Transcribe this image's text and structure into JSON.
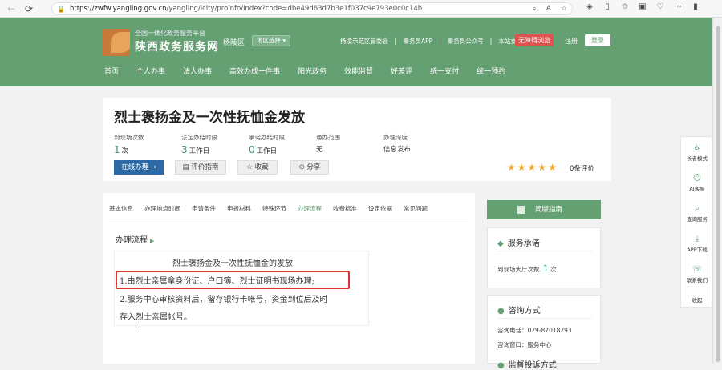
{
  "browser": {
    "back_icon": "←",
    "refresh_icon": "⟳",
    "lock_icon": "🔒",
    "url_host": "https://zwfw.yangling.gov.cn",
    "url_path": "/yangling/icity/proinfo/index?code=dbe49d63d7b3e1f037c9e793e0c0c14b"
  },
  "header": {
    "site_sub": "全国一体化政务服务平台",
    "site_name": "陕西政务服务网",
    "region": "杨陵区",
    "region_select": "地区选择",
    "top_links": [
      "杨凌示范区管委会",
      "秦务员APP",
      "秦务员公众号",
      "本站支持IPv6"
    ],
    "a11y_button": "无障碍浏览",
    "register": "注册",
    "login": "登录",
    "nav": [
      "首页",
      "个人办事",
      "法人办事",
      "高效办成一件事",
      "阳光政务",
      "效能监督",
      "好差评",
      "统一支付",
      "统一预约"
    ]
  },
  "service": {
    "title": "烈士褒扬金及一次性抚恤金发放",
    "stats": [
      {
        "label": "到现场次数",
        "num": "1",
        "unit": "次"
      },
      {
        "label": "法定办结时限",
        "num": "3",
        "unit": "工作日"
      },
      {
        "label": "承诺办结时限",
        "num": "0",
        "unit": "工作日"
      },
      {
        "label": "通办范围",
        "num": "",
        "unit": "无"
      },
      {
        "label": "办理深度",
        "num": "",
        "unit": "信息发布"
      }
    ],
    "online_button": "在线办理 →",
    "guide_button": "评价指南",
    "collect_button": "收藏",
    "share_button": "分享",
    "rating": 5,
    "rating_text": "0条评价"
  },
  "detail": {
    "tabs": [
      "基本信息",
      "办理地点时间",
      "申请条件",
      "申报材料",
      "特殊环节",
      "办理流程",
      "收费标准",
      "设定依据",
      "常见问题"
    ],
    "active_tab": 5,
    "section_title": "办理流程",
    "process_heading": "烈士褒扬金及一次性抚恤金的发放",
    "process_line1": "1.由烈士亲属拿身份证、户口簿、烈士证明书现场办理;",
    "process_line2": "2.服务中心审核资料后，留存银行卡帐号，资金到位后及时",
    "process_line3": "存入烈士亲属帐号。"
  },
  "sidebar": {
    "simple_guide": "简版指南",
    "promise_title": "服务承诺",
    "promise_label": "到现场大厅次数",
    "promise_num": "1",
    "promise_unit": "次",
    "consult_title": "咨询方式",
    "consult_phone": "咨询电话：029-87018293",
    "consult_window": "咨询窗口：服务中心",
    "complaint_title": "监督投诉方式"
  },
  "float_panel": [
    "长者模式",
    "AI客服",
    "查询服务",
    "APP下载",
    "联系我们",
    "收起"
  ],
  "colors": {
    "brand": "#64a072",
    "primary": "#2d6aa5",
    "highlight": "#e03030",
    "star": "#f5a623"
  }
}
